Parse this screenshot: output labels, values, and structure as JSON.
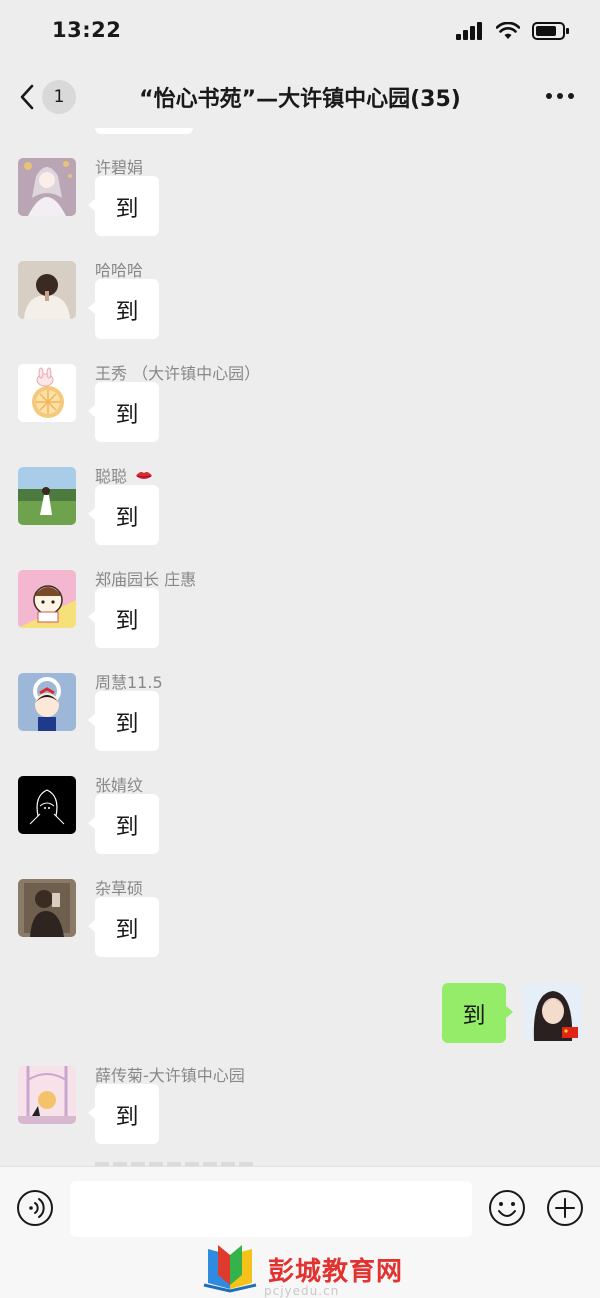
{
  "status_bar": {
    "time": "13:22"
  },
  "nav": {
    "unread_count": "1",
    "title": "“怡心书苑”—大许镇中心园(35)"
  },
  "messages": [
    {
      "sender": "许碧娟",
      "text": "到"
    },
    {
      "sender": "哈哈哈",
      "text": "到"
    },
    {
      "sender": "王秀 （大许镇中心园）",
      "text": "到"
    },
    {
      "sender": "聪聪",
      "text": "到"
    },
    {
      "sender": "郑庙园长 庄惠",
      "text": "到"
    },
    {
      "sender": "周慧11.5",
      "text": "到"
    },
    {
      "sender": "张婧纹",
      "text": "到"
    },
    {
      "sender": "杂草硕",
      "text": "到"
    },
    {
      "sender": "",
      "text": "到",
      "self": true
    },
    {
      "sender": "薛传菊-大许镇中心园",
      "text": "到"
    }
  ],
  "watermark": {
    "text": "彭城教育网",
    "url": "pcjyedu.cn"
  },
  "colors": {
    "self_bubble": "#95ec69",
    "background": "#ededed"
  }
}
